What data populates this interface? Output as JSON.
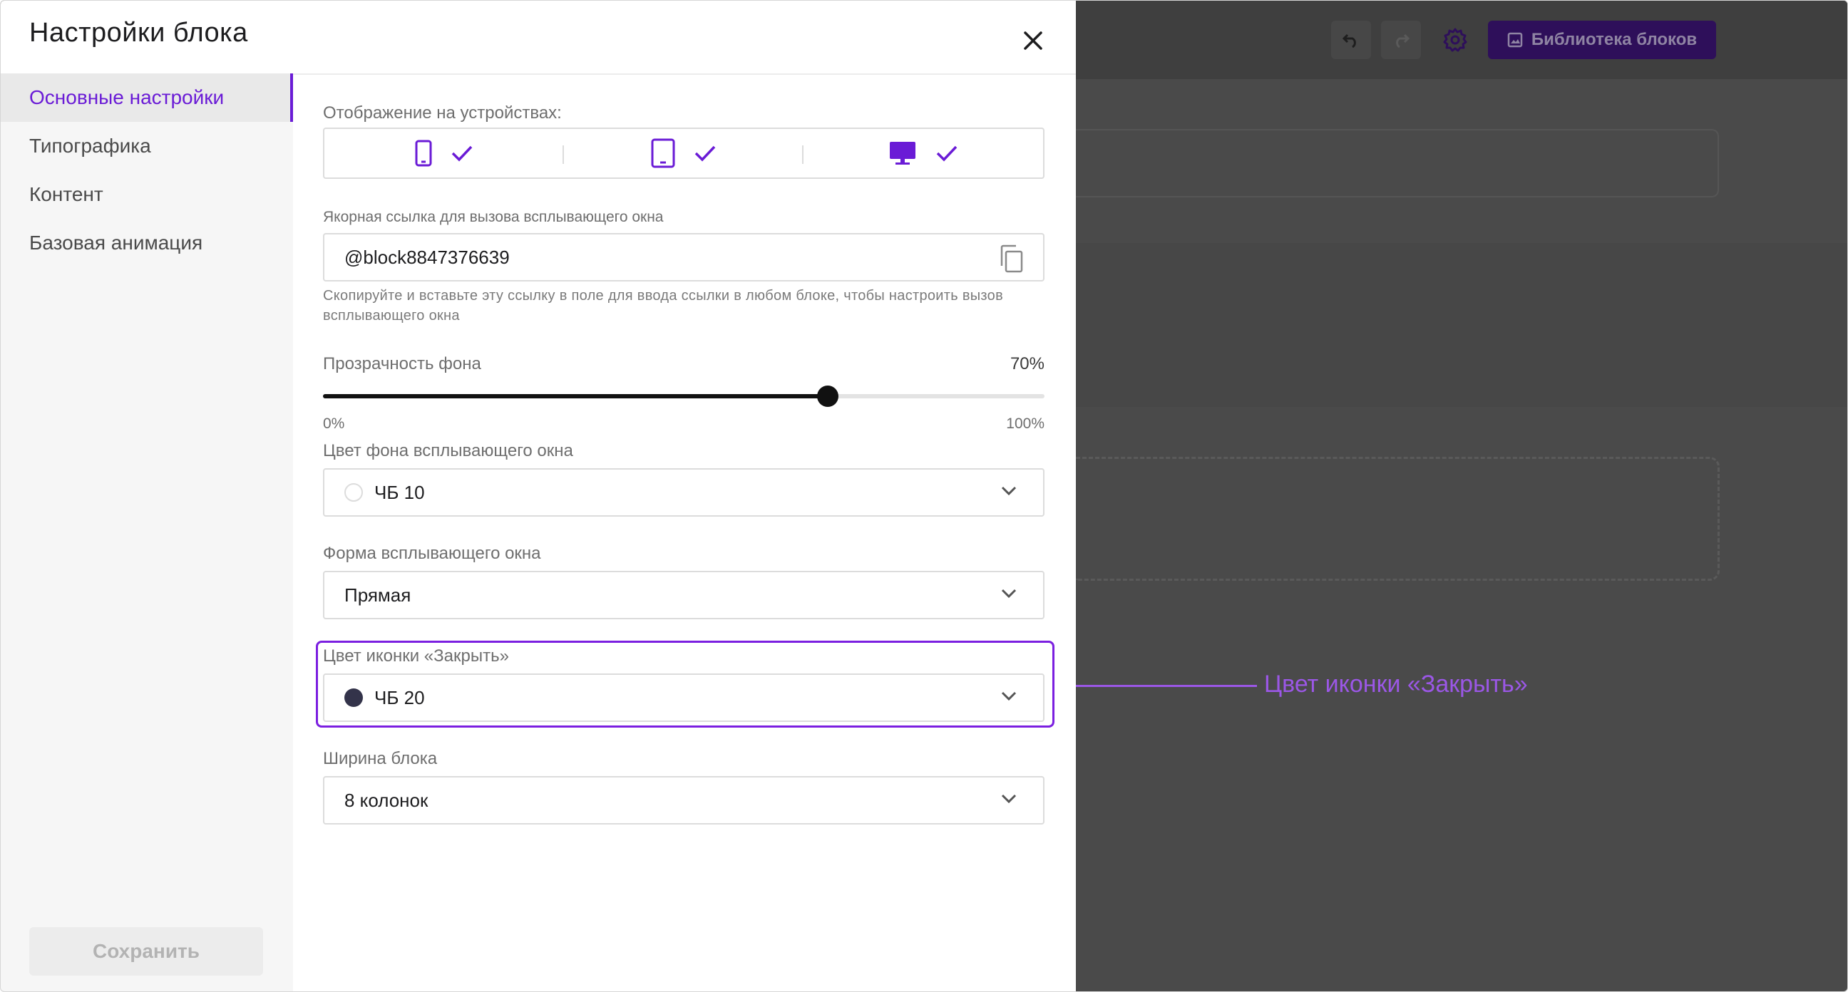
{
  "modal": {
    "title": "Настройки блока"
  },
  "sidebar": {
    "items": [
      {
        "label": "Основные настройки"
      },
      {
        "label": "Типографика"
      },
      {
        "label": "Контент"
      },
      {
        "label": "Базовая анимация"
      }
    ],
    "save_label": "Сохранить"
  },
  "devices": {
    "label": "Отображение на устройствах:",
    "items": [
      {
        "icon": "smartphone-icon",
        "checked": true
      },
      {
        "icon": "tablet-icon",
        "checked": true
      },
      {
        "icon": "desktop-icon",
        "checked": true
      }
    ]
  },
  "anchor": {
    "label": "Якорная ссылка для вызова всплывающего окна",
    "value": "@block8847376639",
    "hint": "Скопируйте и вставьте эту ссылку в поле для ввода ссылки в любом блоке, чтобы настроить вызов всплывающего окна"
  },
  "opacity": {
    "label": "Прозрачность фона",
    "value_text": "70%",
    "value": 70,
    "min_label": "0%",
    "max_label": "100%"
  },
  "bg_color": {
    "label": "Цвет фона всплывающего окна",
    "value": "ЧБ 10",
    "swatch": "#ffffff"
  },
  "shape": {
    "label": "Форма всплывающего окна",
    "value": "Прямая"
  },
  "close_color": {
    "label": "Цвет иконки «Закрыть»",
    "value": "ЧБ 20",
    "swatch": "#33334a"
  },
  "width": {
    "label": "Ширина блока",
    "value": "8 колонок"
  },
  "callout": {
    "text": "Цвет иконки «Закрыть»"
  },
  "toolbar": {
    "library_label": "Библиотека блоков"
  },
  "colors": {
    "accent": "#6a1bd6",
    "callout": "#9b57e6",
    "library_button_bg": "#2e0f5a"
  }
}
